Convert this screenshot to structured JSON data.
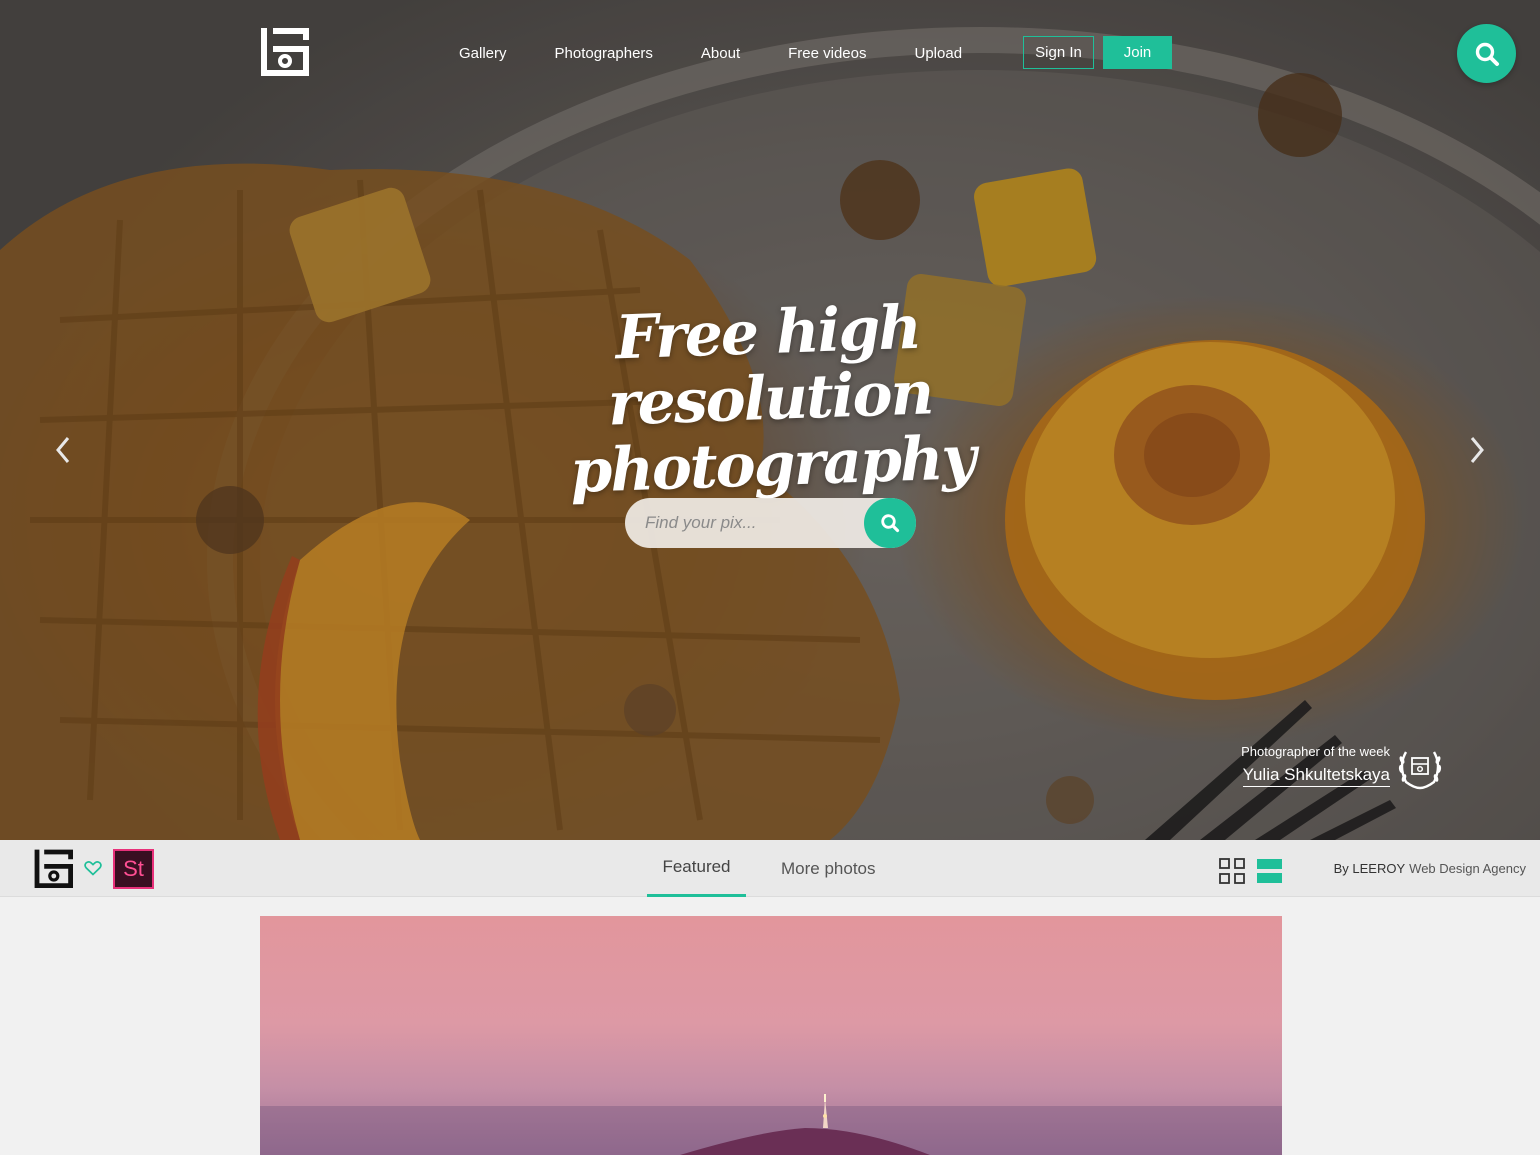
{
  "nav": {
    "items": [
      "Gallery",
      "Photographers",
      "About",
      "Free videos",
      "Upload"
    ],
    "signin_label": "Sign In",
    "join_label": "Join"
  },
  "hero": {
    "headline_line1": "Free high resolution",
    "headline_line2": "photography",
    "search_placeholder": "Find your pix...",
    "photographer_label": "Photographer of the week",
    "photographer_name": "Yulia Shkultetskaya"
  },
  "subbar": {
    "stock_label": "St",
    "tabs": [
      "Featured",
      "More photos"
    ],
    "active_tab": "Featured",
    "credit_by": "By LEEROY",
    "credit_rest": "Web Design Agency"
  },
  "colors": {
    "accent": "#1fbf99",
    "stock_pink": "#e8317a"
  },
  "icons": [
    "site-logo-icon",
    "search-icon",
    "chevron-left-icon",
    "chevron-right-icon",
    "laurel-badge-icon",
    "heart-icon",
    "grid-view-icon",
    "list-view-icon"
  ]
}
